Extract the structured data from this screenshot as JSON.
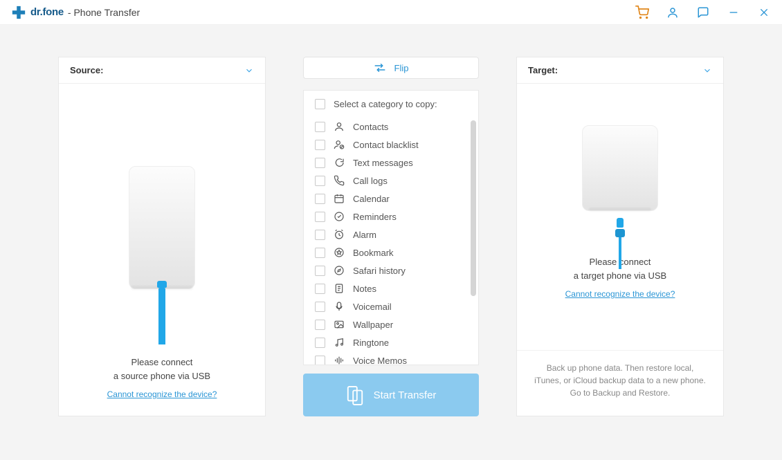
{
  "titlebar": {
    "brand": "dr.fone",
    "subtitle": "- Phone Transfer"
  },
  "source": {
    "label": "Source:",
    "connect_prompt_line1": "Please connect",
    "connect_prompt_line2": "a source phone via USB",
    "unrecognized_link": "Cannot recognize the device?"
  },
  "target": {
    "label": "Target:",
    "connect_prompt_line1": "Please connect",
    "connect_prompt_line2": "a target phone via USB",
    "unrecognized_link": "Cannot recognize the device?",
    "backup_note": "Back up phone data. Then restore local, iTunes, or iCloud backup data to a new phone. Go to Backup and Restore."
  },
  "middle": {
    "flip_label": "Flip",
    "select_header": "Select a category to copy:",
    "start_label": "Start Transfer",
    "categories": [
      "Contacts",
      "Contact blacklist",
      "Text messages",
      "Call logs",
      "Calendar",
      "Reminders",
      "Alarm",
      "Bookmark",
      "Safari history",
      "Notes",
      "Voicemail",
      "Wallpaper",
      "Ringtone",
      "Voice Memos"
    ]
  },
  "colors": {
    "accent": "#2a95d5",
    "cart": "#e0861a"
  }
}
